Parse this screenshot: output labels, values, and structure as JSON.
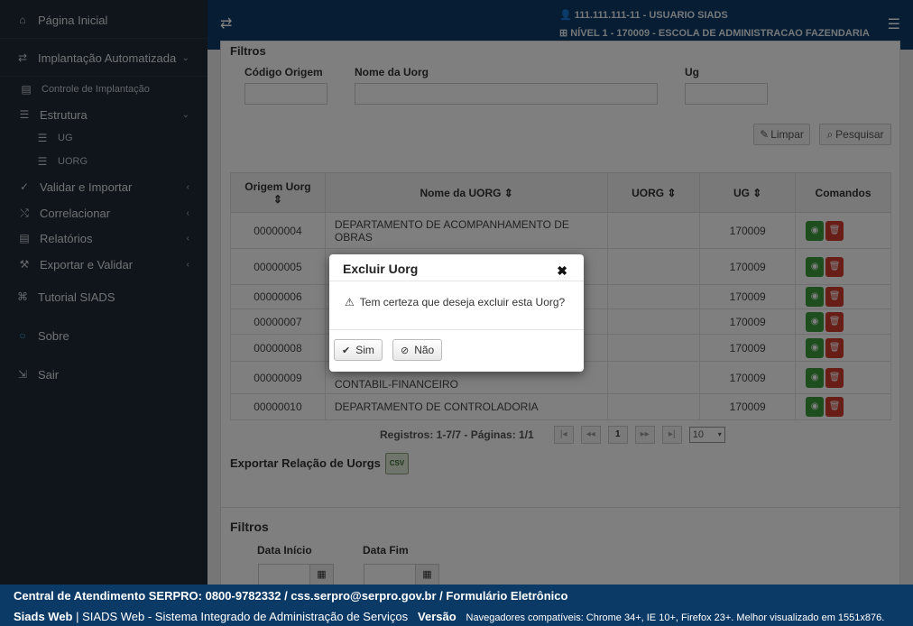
{
  "sidebar": {
    "items": [
      {
        "label": "Página Inicial",
        "icon": "home-icon",
        "glyph": "⌂"
      },
      {
        "label": "Implantação Automatizada",
        "icon": "exchange-icon",
        "glyph": "⇄"
      },
      {
        "label": "Controle de Implantação",
        "icon": "table-icon",
        "glyph": "▤"
      },
      {
        "label": "Estrutura",
        "icon": "list-icon",
        "glyph": "☰"
      },
      {
        "label": "UG",
        "icon": "list-icon",
        "glyph": "☰"
      },
      {
        "label": "UORG",
        "icon": "list-icon",
        "glyph": "☰"
      },
      {
        "label": "Validar e Importar",
        "icon": "check-icon",
        "glyph": "✓"
      },
      {
        "label": "Correlacionar",
        "icon": "shuffle-icon",
        "glyph": "⤭"
      },
      {
        "label": "Relatórios",
        "icon": "table-icon",
        "glyph": "▤"
      },
      {
        "label": "Exportar e Validar",
        "icon": "gavel-icon",
        "glyph": "⚒"
      },
      {
        "label": "Tutorial SIADS",
        "icon": "graduation-icon",
        "glyph": "🎓"
      },
      {
        "label": "Sobre",
        "icon": "circle-icon",
        "glyph": "○"
      },
      {
        "label": "Sair",
        "icon": "sign-out-icon",
        "glyph": "⇲"
      }
    ]
  },
  "topbar": {
    "user": "111.111.111-11 - USUARIO SIADS",
    "level": "NÍVEL 1 - 170009 - ESCOLA DE ADMINISTRACAO FAZENDARIA"
  },
  "filters": {
    "title": "Filtros",
    "codigo_origem_label": "Código Origem",
    "nome_uorg_label": "Nome da Uorg",
    "ug_label": "Ug",
    "limpar": "Limpar",
    "pesquisar": "Pesquisar"
  },
  "table": {
    "headers": [
      "Origem Uorg",
      "Nome da UORG",
      "UORG",
      "UG",
      "Comandos"
    ],
    "rows": [
      {
        "origem": "00000004",
        "nome": "DEPARTAMENTO DE ACOMPANHAMENTO DE OBRAS",
        "uorg": "",
        "ug": "170009"
      },
      {
        "origem": "00000005",
        "nome": "",
        "uorg": "",
        "ug": "170009"
      },
      {
        "origem": "00000006",
        "nome": "",
        "uorg": "",
        "ug": "170009"
      },
      {
        "origem": "00000007",
        "nome": "",
        "uorg": "",
        "ug": "170009"
      },
      {
        "origem": "00000008",
        "nome": "",
        "uorg": "",
        "ug": "170009"
      },
      {
        "origem": "00000009",
        "nome": "CONTABIL-FINANCEIRO",
        "uorg": "",
        "ug": "170009"
      },
      {
        "origem": "00000010",
        "nome": "DEPARTAMENTO DE CONTROLADORIA",
        "uorg": "",
        "ug": "170009"
      }
    ]
  },
  "pager": {
    "info": "Registros: 1-7/7 - Páginas: 1/1",
    "current_page": "1",
    "page_size": "10"
  },
  "export": {
    "label": "Exportar Relação de Uorgs",
    "csv": "CSV"
  },
  "filters2": {
    "title": "Filtros",
    "data_inicio": "Data Início",
    "data_fim": "Data Fim"
  },
  "modal": {
    "title": "Excluir Uorg",
    "message": "Tem certeza que deseja excluir esta Uorg?",
    "yes": "Sim",
    "no": "Não"
  },
  "footer": {
    "line1": "Central de Atendimento SERPRO: 0800-9782332 / css.serpro@serpro.gov.br / Formulário Eletrônico",
    "brand": "Siads Web",
    "system": " | SIADS Web - Sistema Integrado de Administração de Serviços",
    "versao": "Versão",
    "browsers": "Navegadores compatíveis: Chrome 34+, IE 10+, Firefox 23+. Melhor visualizado em 1551x876."
  }
}
